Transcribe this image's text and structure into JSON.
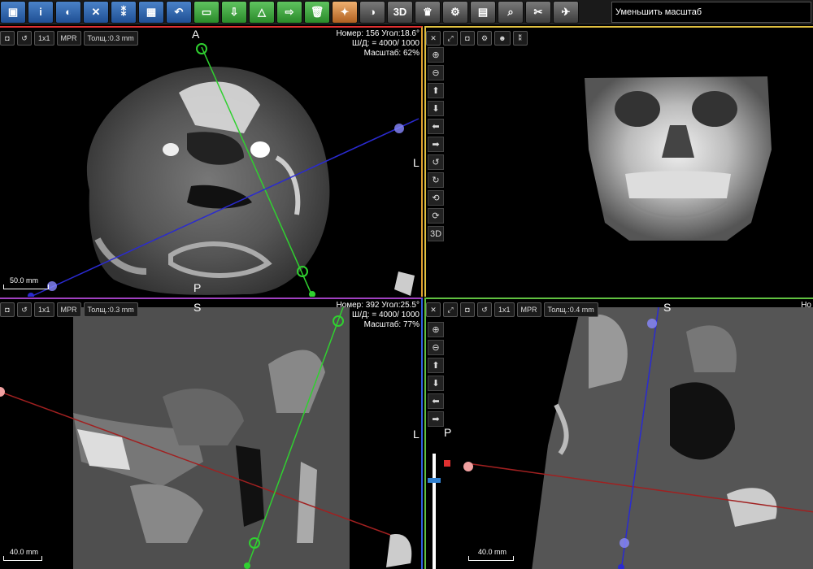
{
  "toolbar": {
    "buttons": [
      {
        "name": "save-icon",
        "glyph": "▣",
        "color": "blue"
      },
      {
        "name": "info-icon",
        "glyph": "i",
        "color": "blue"
      },
      {
        "name": "settings-icon",
        "glyph": "◐",
        "color": "blue"
      },
      {
        "name": "tools-icon",
        "glyph": "✕",
        "color": "blue"
      },
      {
        "name": "implant-icon",
        "glyph": "⁑",
        "color": "blue"
      },
      {
        "name": "calculator-icon",
        "glyph": "▦",
        "color": "blue"
      },
      {
        "name": "undo-icon",
        "glyph": "↶",
        "color": "blue"
      },
      {
        "name": "ruler-icon",
        "glyph": "▭",
        "color": "green"
      },
      {
        "name": "import-icon",
        "glyph": "⇩",
        "color": "green"
      },
      {
        "name": "angle-icon",
        "glyph": "△",
        "color": "green"
      },
      {
        "name": "export-icon",
        "glyph": "⇨",
        "color": "green"
      },
      {
        "name": "trash-icon",
        "glyph": "🗑",
        "color": "green"
      },
      {
        "name": "light-icon",
        "glyph": "✦",
        "color": "orange"
      },
      {
        "name": "contrast-icon",
        "glyph": "◑",
        "color": "gray"
      },
      {
        "name": "3d-button",
        "glyph": "3D",
        "color": "gray"
      },
      {
        "name": "crown-icon",
        "glyph": "♛",
        "color": "gray"
      },
      {
        "name": "gear-icon",
        "glyph": "⚙",
        "color": "gray"
      },
      {
        "name": "filter-icon",
        "glyph": "▤",
        "color": "gray"
      },
      {
        "name": "magnify-icon",
        "glyph": "⌕",
        "color": "gray"
      },
      {
        "name": "scissors-icon",
        "glyph": "✂",
        "color": "gray"
      },
      {
        "name": "plane-icon",
        "glyph": "✈",
        "color": "gray"
      }
    ],
    "tooltip": "Уменьшить масштаб"
  },
  "axial": {
    "btn_1x1": "1x1",
    "btn_mpr": "MPR",
    "thickness": "Толщ.:0.3 mm",
    "info_line1": "Номер: 156 Угол:18.6°",
    "info_line2": "Ш/Д: = 4000/ 1000",
    "info_line3": "Масштаб: 62%",
    "orient_top": "A",
    "orient_bottom": "P",
    "orient_right": "L",
    "scale_label": "50.0 mm"
  },
  "view3d": {
    "vbuttons": [
      {
        "name": "zoom-in-icon",
        "glyph": "⊕"
      },
      {
        "name": "zoom-out-icon",
        "glyph": "⊖"
      },
      {
        "name": "arrow-up-icon",
        "glyph": "⬆"
      },
      {
        "name": "arrow-down-icon",
        "glyph": "⬇"
      },
      {
        "name": "arrow-left-icon",
        "glyph": "⬅"
      },
      {
        "name": "arrow-right-icon",
        "glyph": "➡"
      },
      {
        "name": "rotate-left-icon",
        "glyph": "↺"
      },
      {
        "name": "rotate-right-icon",
        "glyph": "↻"
      },
      {
        "name": "rotate-up-icon",
        "glyph": "⟲"
      },
      {
        "name": "rotate-down-icon",
        "glyph": "⟳"
      },
      {
        "name": "3d-mode-button",
        "glyph": "3D"
      }
    ]
  },
  "coronal": {
    "btn_1x1": "1x1",
    "btn_mpr": "MPR",
    "thickness": "Толщ.:0.3 mm",
    "info_line1": "Номер: 392 Угол:25.5°",
    "info_line2": "Ш/Д: = 4000/ 1000",
    "info_line3": "Масштаб: 77%",
    "orient_top": "S",
    "orient_right": "L",
    "scale_label": "40.0 mm"
  },
  "sagittal": {
    "btn_1x1": "1x1",
    "btn_mpr": "MPR",
    "thickness": "Толщ.:0.4 mm",
    "info_line1": "Но",
    "orient_top": "S",
    "orient_left": "P",
    "scale_label": "40.0 mm"
  }
}
